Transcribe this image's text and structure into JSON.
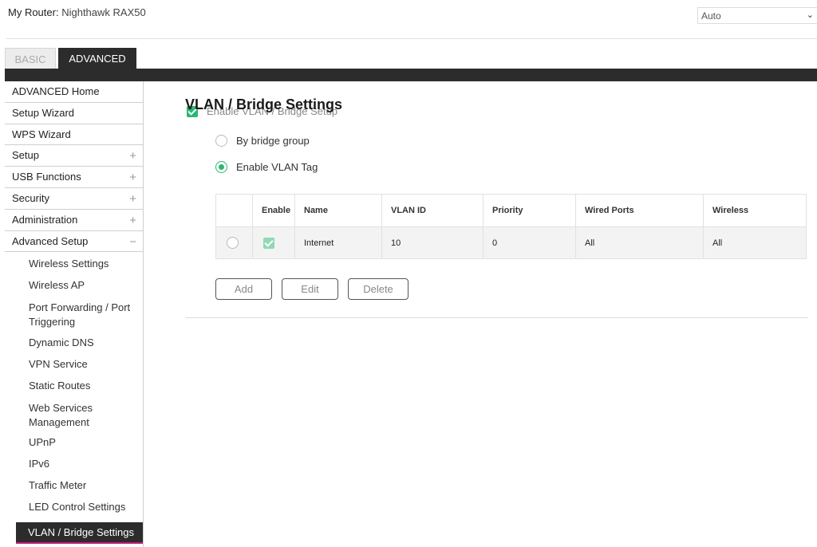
{
  "header": {
    "router_label": "My Router:",
    "router_model": "Nighthawk RAX50",
    "language_select": "Auto"
  },
  "tabs": [
    {
      "label": "BASIC",
      "active": false
    },
    {
      "label": "ADVANCED",
      "active": true
    }
  ],
  "sidebar": {
    "items": [
      {
        "label": "ADVANCED Home",
        "expander": ""
      },
      {
        "label": "Setup Wizard",
        "expander": ""
      },
      {
        "label": "WPS Wizard",
        "expander": ""
      },
      {
        "label": "Setup",
        "expander": "+"
      },
      {
        "label": "USB Functions",
        "expander": "+"
      },
      {
        "label": "Security",
        "expander": "+"
      },
      {
        "label": "Administration",
        "expander": "+"
      },
      {
        "label": "Advanced Setup",
        "expander": "−"
      }
    ],
    "sub_items": [
      {
        "label": "Wireless Settings"
      },
      {
        "label": "Wireless AP"
      },
      {
        "label": "Port Forwarding / Port Triggering"
      },
      {
        "label": "Dynamic DNS"
      },
      {
        "label": "VPN Service"
      },
      {
        "label": "Static Routes"
      },
      {
        "label": "Web Services Management"
      },
      {
        "label": "UPnP"
      },
      {
        "label": "IPv6"
      },
      {
        "label": "Traffic Meter"
      },
      {
        "label": "LED Control Settings"
      },
      {
        "label": "VLAN / Bridge Settings",
        "active": true
      }
    ]
  },
  "main": {
    "title": "VLAN / Bridge Settings",
    "enable_checkbox_label": "Enable VLAN / Bridge Setup",
    "enable_checked": true,
    "radio_options": [
      {
        "label": "By bridge group",
        "selected": false
      },
      {
        "label": "Enable VLAN Tag",
        "selected": true
      }
    ],
    "table": {
      "headers": [
        "",
        "Enable",
        "Name",
        "VLAN ID",
        "Priority",
        "Wired Ports",
        "Wireless"
      ],
      "rows": [
        {
          "enabled": true,
          "name": "Internet",
          "vlan_id": "10",
          "priority": "0",
          "wired_ports": "All",
          "wireless": "All"
        }
      ]
    },
    "buttons": {
      "add": "Add",
      "edit": "Edit",
      "delete": "Delete"
    }
  },
  "colors": {
    "accent_green": "#2bb673",
    "dark_bar": "#2c2c2c",
    "active_underline": "#c21f7a"
  }
}
